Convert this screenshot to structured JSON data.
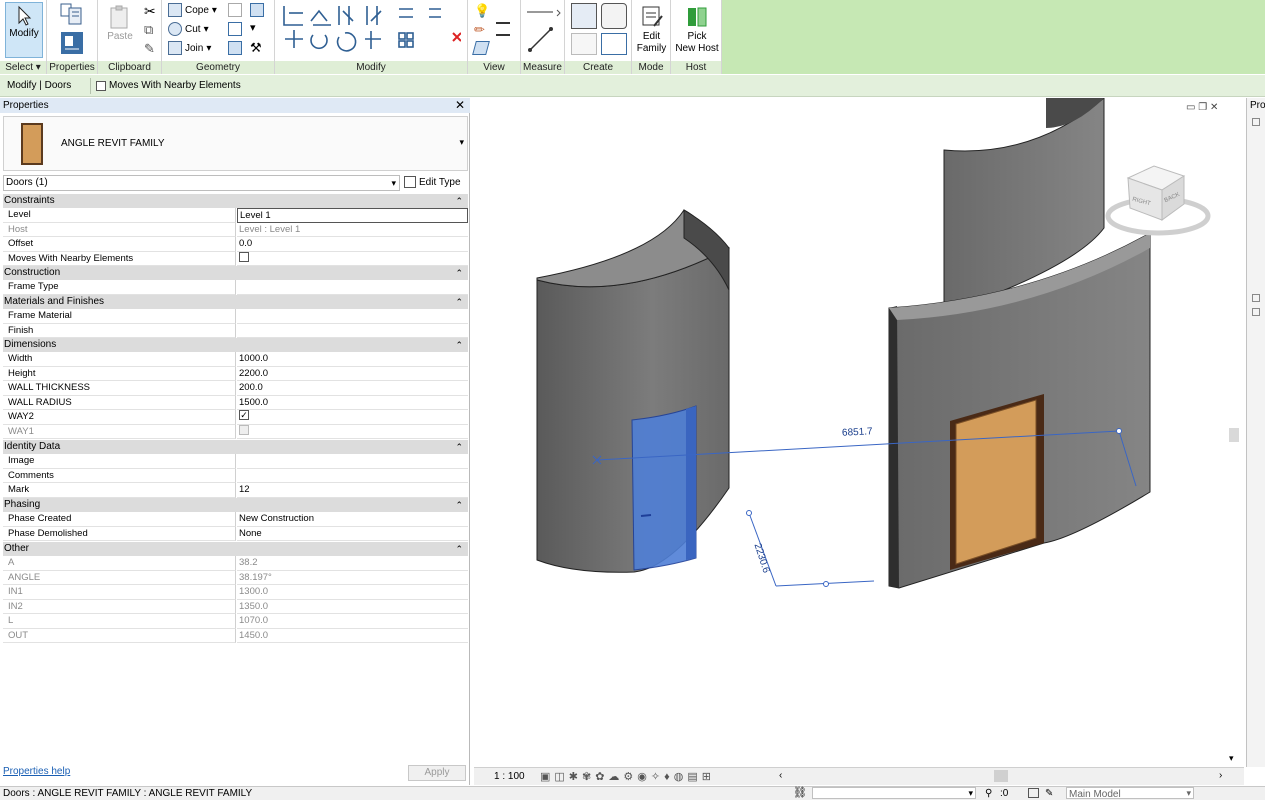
{
  "ribbon": {
    "panels": {
      "select": "Select",
      "properties": "Properties",
      "clipboard": "Clipboard",
      "geometry": "Geometry",
      "modify": "Modify",
      "view": "View",
      "measure": "Measure",
      "create": "Create",
      "mode": "Mode",
      "host": "Host"
    },
    "modify_button": "Modify",
    "paste_button": "Paste",
    "cope": "Cope",
    "cut": "Cut",
    "join": "Join",
    "edit_family_line1": "Edit",
    "edit_family_line2": "Family",
    "pick_host_line1": "Pick",
    "pick_host_line2": "New Host"
  },
  "options_bar": {
    "context": "Modify | Doors",
    "moves_with_nearby": "Moves With Nearby Elements"
  },
  "properties": {
    "title": "Properties",
    "family_name": "ANGLE REVIT FAMILY",
    "selector": "Doors (1)",
    "edit_type": "Edit Type",
    "help_link": "Properties help",
    "apply": "Apply",
    "groups": {
      "constraints": "Constraints",
      "construction": "Construction",
      "materials": "Materials and Finishes",
      "dimensions": "Dimensions",
      "identity": "Identity Data",
      "phasing": "Phasing",
      "other": "Other"
    },
    "rows": {
      "level": {
        "k": "Level",
        "v": "Level 1"
      },
      "host": {
        "k": "Host",
        "v": "Level : Level 1"
      },
      "offset": {
        "k": "Offset",
        "v": "0.0"
      },
      "moves": {
        "k": "Moves With Nearby Elements"
      },
      "frame_type": {
        "k": "Frame Type"
      },
      "frame_material": {
        "k": "Frame Material"
      },
      "finish": {
        "k": "Finish"
      },
      "width": {
        "k": "Width",
        "v": "1000.0"
      },
      "height": {
        "k": "Height",
        "v": "2200.0"
      },
      "wall_thickness": {
        "k": "WALL THICKNESS",
        "v": "200.0"
      },
      "wall_radius": {
        "k": "WALL RADIUS",
        "v": "1500.0"
      },
      "way2": {
        "k": "WAY2"
      },
      "way1": {
        "k": "WAY1"
      },
      "image": {
        "k": "Image"
      },
      "comments": {
        "k": "Comments"
      },
      "mark": {
        "k": "Mark",
        "v": "12"
      },
      "phase_created": {
        "k": "Phase Created",
        "v": "New Construction"
      },
      "phase_demolished": {
        "k": "Phase Demolished",
        "v": "None"
      },
      "a": {
        "k": "A",
        "v": "38.2"
      },
      "angle": {
        "k": "ANGLE",
        "v": "38.197°"
      },
      "in1": {
        "k": "IN1",
        "v": "1300.0"
      },
      "in2": {
        "k": "IN2",
        "v": "1350.0"
      },
      "l": {
        "k": "L",
        "v": "1070.0"
      },
      "out": {
        "k": "OUT",
        "v": "1450.0"
      }
    }
  },
  "viewport": {
    "dim_long": "6851.7",
    "dim_short": "2230.6",
    "viewcube_right": "RIGHT",
    "viewcube_back": "BACK",
    "scale": "1 : 100"
  },
  "right_pane": {
    "title": "Pro"
  },
  "status": {
    "text": "Doors : ANGLE REVIT FAMILY : ANGLE REVIT FAMILY",
    "count": ":0",
    "model": "Main Model"
  },
  "colors": {
    "ribbon_green": "#c6e8b4",
    "wall": "#6e6e6e",
    "door_selected": "#4f7fd6",
    "door_panel": "#d39c5a"
  }
}
